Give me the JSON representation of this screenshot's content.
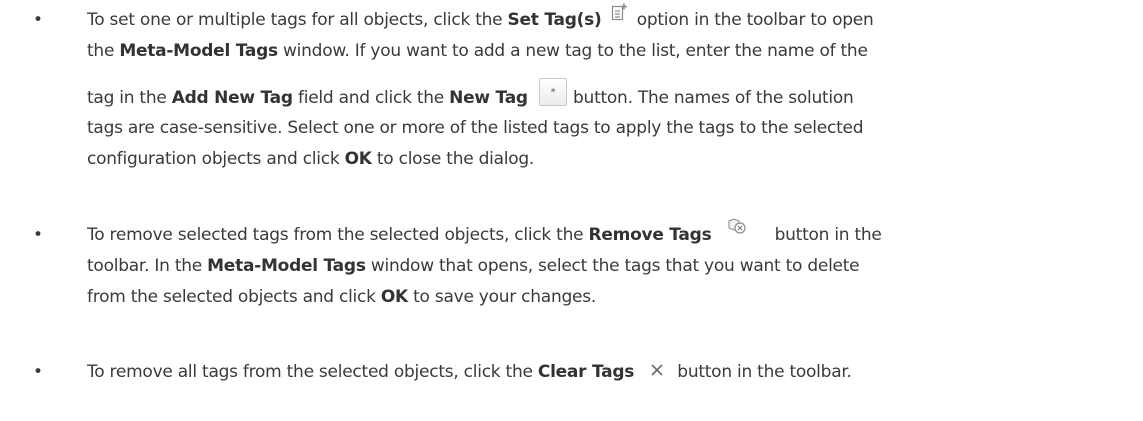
{
  "bullet_char": "•",
  "items": [
    {
      "lines": [
        {
          "t1": "To set one or multiple tags for all objects, click the ",
          "b1": "Set Tag(s)",
          "icon": "set-tag-icon",
          "t2": "option in the toolbar to open"
        },
        {
          "t1": "the ",
          "b1": "Meta-Model Tags",
          "t2": " window. If you want to add a new tag to the list, enter the name of the"
        },
        {
          "t1": "tag in the ",
          "b1": "Add New Tag",
          "t2": " field and click the ",
          "b2": "New Tag",
          "icon": "new-tag-button-icon",
          "t3": "button. The names of the solution"
        },
        {
          "t1": "tags are case-sensitive. Select one or more of the listed tags to apply the tags to the selected"
        },
        {
          "t1": "configuration objects and click ",
          "b1": "OK",
          "t2": " to close the dialog."
        }
      ]
    },
    {
      "lines": [
        {
          "t1": "To remove selected tags from the selected objects, click the ",
          "b1": "Remove Tags",
          "icon": "remove-tags-icon",
          "t2": "button in the"
        },
        {
          "t1": "toolbar. In the ",
          "b1": "Meta-Model Tags",
          "t2": " window that opens, select the tags that you want to delete"
        },
        {
          "t1": "from the selected objects and click ",
          "b1": "OK",
          "t2": " to save your changes."
        }
      ]
    },
    {
      "lines": [
        {
          "t1": "To remove all tags from the selected objects, click the ",
          "b1": "Clear Tags",
          "icon": "clear-tags-icon",
          "t2": "button in the toolbar."
        }
      ]
    }
  ],
  "new_tag_button_glyph": "*",
  "colors": {
    "text": "#3a3a3a",
    "bold_text": "#333333",
    "icon_gray": "#8a8a8a"
  }
}
